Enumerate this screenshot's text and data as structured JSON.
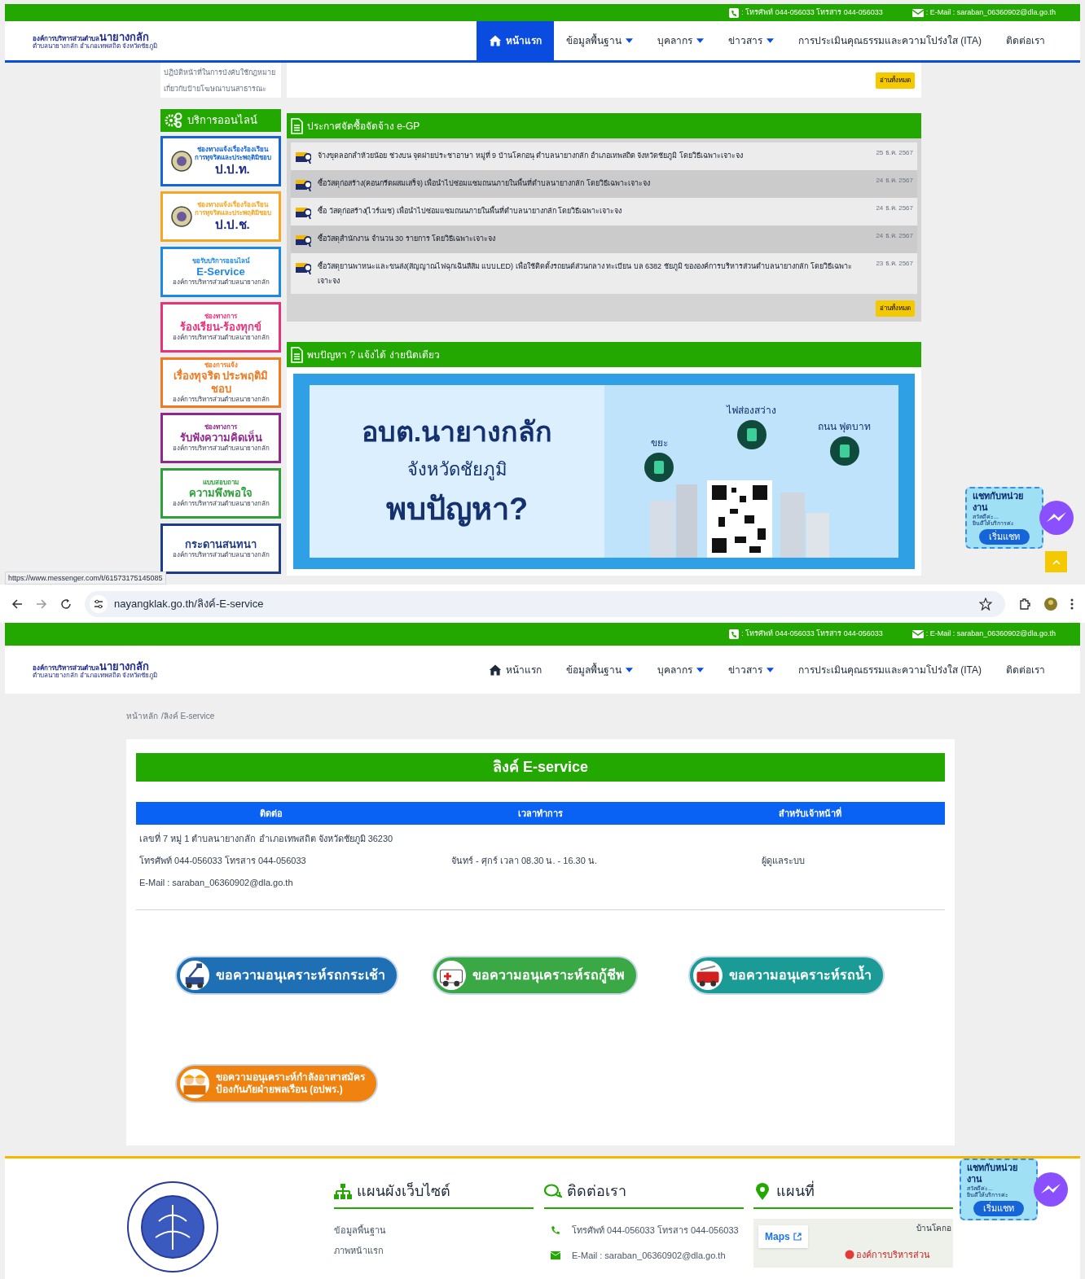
{
  "screen_1": {
    "contact_bar": {
      "phone": ": โทรศัพท์ 044-056033 โทรสาร 044-056033",
      "email": ": E-Mail : saraban_06360902@dla.go.th"
    },
    "logo": {
      "prefix": "องค์การบริหารส่วนตำบล",
      "name": "นายางกลัก",
      "subtitle": "ตำบลนายางกลัก อำเภอเทพสถิต จังหวัดชัยภูมิ"
    },
    "nav": [
      {
        "label": "หน้าแรก",
        "kind": "home",
        "selected": true
      },
      {
        "label": "ข้อมูลพื้นฐาน",
        "kind": "dropdown",
        "selected": false
      },
      {
        "label": "บุคลากร",
        "kind": "dropdown",
        "selected": false
      },
      {
        "label": "ข่าวสาร",
        "kind": "dropdown",
        "selected": false
      },
      {
        "label": "การประเมินคุณธรรมและความโปร่งใส (ITA)",
        "kind": "link",
        "selected": false
      },
      {
        "label": "ติดต่อเรา",
        "kind": "link",
        "selected": false
      }
    ],
    "previous_panel": {
      "lines": [
        "ปฏิบัติหน้าที่ในการบังคับใช้กฎหมาย",
        "เกี่ยวกับป้ายโฆษณาบนสาธารณะ"
      ],
      "read_all": "อ่านทั้งหมด"
    },
    "online_services": {
      "title": "บริการออนไลน์",
      "banners": [
        {
          "kind": "agency",
          "color": "#1565d8",
          "lines": [
            "ช่องทางแจ้งเรื่องร้องเรียน",
            "การทุจริตและประพฤติมิชอบ"
          ],
          "main": "ป.ป.ท."
        },
        {
          "kind": "agency",
          "color": "#f5a623",
          "lines": [
            "ช่องทางแจ้งเรื่องร้องเรียน",
            "การทุจริตและประพฤติมิชอบ"
          ],
          "main": "ป.ป.ช."
        },
        {
          "kind": "service",
          "color": "#1e88e5",
          "lines": [
            "ขอรับบริการออนไลน์"
          ],
          "main": "E-Service",
          "footer": "องค์การบริหารส่วนตำบลนายางกลัก"
        },
        {
          "kind": "service",
          "color": "#e8337a",
          "lines": [
            "ช่องทางการ"
          ],
          "main": "ร้องเรียน-ร้องทุกข์",
          "footer": "องค์การบริหารส่วนตำบลนายางกลัก"
        },
        {
          "kind": "service",
          "color": "#f07a22",
          "lines": [
            "ช่องการแจ้ง"
          ],
          "main": "เรื่องทุจริต ประพฤติมิชอบ",
          "footer": "องค์การบริหารส่วนตำบลนายางกลัก"
        },
        {
          "kind": "service",
          "color": "#8e2a8c",
          "lines": [
            "ช่องทางการ"
          ],
          "main": "รับฟังความคิดเห็น",
          "footer": "องค์การบริหารส่วนตำบลนายางกลัก"
        },
        {
          "kind": "service",
          "color": "#2e9e3a",
          "lines": [
            "แบบสอบถาม"
          ],
          "main": "ความพึงพอใจ",
          "footer": "องค์การบริหารส่วนตำบลนายางกลัก"
        },
        {
          "kind": "service",
          "color": "#1f3c88",
          "main": "กระดานสนทนา",
          "footer": "องค์การบริหารส่วนตำบลนายางกลัก"
        }
      ]
    },
    "procurement": {
      "title": "ประกาศจัดซื้อจัดจ้าง e-GP",
      "items": [
        {
          "text": "จ้างขุดลอกลำห้วยน้อย ช่วงบน จุดฝายประชาอาษา หมู่ที่ 9 บ้านโคกอนุ ตำบลนายางกลัก อำเภอเทพสถิต จังหวัดชัยภูมิ โดยวิธีเฉพาะเจาะจง",
          "date": "25 ธ.ค. 2567"
        },
        {
          "text": "ซื้อวัสดุก่อสร้าง(คอนกรีตผสมเสร็จ) เพื่อนำไปซ่อมแซมถนนภายในพื้นที่ตำบลนายางกลัก โดยวิธีเฉพาะเจาะจง",
          "date": "24 ธ.ค. 2567"
        },
        {
          "text": "ซื้อ วัสดุก่อสร้าง(ไวร์เมช) เพื่อนำไปซ่อมแซมถนนภายในพื้นที่ตำบลนายางกลัก โดยวิธีเฉพาะเจาะจง",
          "date": "24 ธ.ค. 2567"
        },
        {
          "text": "ซื้อวัสดุสำนักงาน จำนวน 30 รายการ โดยวิธีเฉพาะเจาะจง",
          "date": "24 ธ.ค. 2567"
        },
        {
          "text": "ซื้อวัสดุยานพาหนะและขนส่ง(สัญญาณไฟฉุกเฉินสีส้ม แบบLED) เพื่อใช้ติดตั้งรถยนต์ส่วนกลาง ทะเบียน บล 6382 ชัยภูมิ ขององค์การบริหารส่วนตำบลนายางกลัก โดยวิธีเฉพาะเจาะจง",
          "date": "23 ธ.ค. 2567"
        }
      ],
      "read_all": "อ่านทั้งหมด"
    },
    "report_problem": {
      "title": "พบปัญหา ? แจ้งได้ ง่ายนิดเดียว",
      "banner": {
        "heading": "อบต.นายางกลัก",
        "subheading": "จังหวัดชัยภูมิ",
        "tagline": "พบปัญหา?",
        "labels": [
          "ขยะ",
          "ไฟส่องสว่าง",
          "ถนน ฟุตบาท"
        ]
      }
    },
    "status_url": "https://www.messenger.com/t/61573175145085",
    "chat_widget": {
      "title": "แชทกับหน่วยงาน",
      "greeting": "สวัสดีค่ะ...",
      "welcome": "ยินดีให้บริการค่ะ",
      "button": "เริ่มแชท"
    }
  },
  "screen_2": {
    "address_bar": "nayangklak.go.th/ลิงค์-E-service",
    "contact_bar": {
      "phone": ": โทรศัพท์ 044-056033 โทรสาร 044-056033",
      "email": ": E-Mail : saraban_06360902@dla.go.th"
    },
    "logo": {
      "prefix": "องค์การบริหารส่วนตำบล",
      "name": "นายางกลัก",
      "subtitle": "ตำบลนายางกลัก อำเภอเทพสถิต จังหวัดชัยภูมิ"
    },
    "nav": [
      {
        "label": "หน้าแรก",
        "kind": "home",
        "selected": false
      },
      {
        "label": "ข้อมูลพื้นฐาน",
        "kind": "dropdown",
        "selected": false
      },
      {
        "label": "บุคลากร",
        "kind": "dropdown",
        "selected": false
      },
      {
        "label": "ข่าวสาร",
        "kind": "dropdown",
        "selected": false
      },
      {
        "label": "การประเมินคุณธรรมและความโปร่งใส (ITA)",
        "kind": "link",
        "selected": false
      },
      {
        "label": "ติดต่อเรา",
        "kind": "link",
        "selected": false
      }
    ],
    "breadcrumb": [
      "หน้าหลัก",
      "/ลิงค์ E-service"
    ],
    "page_title": "ลิงค์ E-service",
    "table": {
      "columns": [
        "ติดต่อ",
        "เวลาทำการ",
        "สำหรับเจ้าหน้าที่"
      ],
      "contact_lines": [
        "เลขที่ 7 หมู่ 1 ตำบลนายางกลัก อำเภอเทพสถิต จังหวัดชัยภูมิ 36230",
        "โทรศัพท์ 044-056033 โทรสาร 044-056033",
        "E-Mail : saraban_06360902@dla.go.th"
      ],
      "hours": "จันทร์ - ศุกร์ เวลา 08.30 น. - 16.30 น.",
      "staff": "ผู้ดูแลระบบ"
    },
    "service_buttons": [
      {
        "kind": "bucket-truck",
        "color": "#1f6fb5",
        "lines": [
          "ขอความอนุเคราะห์รถกระเช้า"
        ]
      },
      {
        "kind": "ambulance",
        "color": "#3aa845",
        "lines": [
          "ขอความอนุเคราะห์รถกู้ชีพ"
        ]
      },
      {
        "kind": "water-truck",
        "color": "#1b9b96",
        "lines": [
          "ขอความอนุเคราะห์รถน้ำ"
        ]
      },
      {
        "kind": "volunteers",
        "color": "#f0820f",
        "lines": [
          "ขอความอนุเคราะห์กำลังอาสาสมัคร",
          "ป้องกันภัยฝ่ายพลเรือน (อปพร.)"
        ]
      }
    ],
    "footer": {
      "sitemap": {
        "title": "แผนผังเว็บไซต์",
        "links": [
          "ข้อมูลพื้นฐาน",
          "ภาพหน้าแรก"
        ]
      },
      "contact": {
        "title": "ติดต่อเรา",
        "phone": "โทรศัพท์ 044-056033 โทรสาร 044-056033",
        "email": "E-Mail : saraban_06360902@dla.go.th"
      },
      "map": {
        "title": "แผนที่",
        "maps_link": "Maps",
        "village": "บ้านโคกอ",
        "place": "องค์การบริหารส่วน"
      }
    },
    "chat_widget": {
      "title": "แชทกับหน่วยงาน",
      "greeting": "สวัสดีค่ะ...",
      "welcome": "ยินดีให้บริการค่ะ",
      "button": "เริ่มแชท"
    }
  }
}
